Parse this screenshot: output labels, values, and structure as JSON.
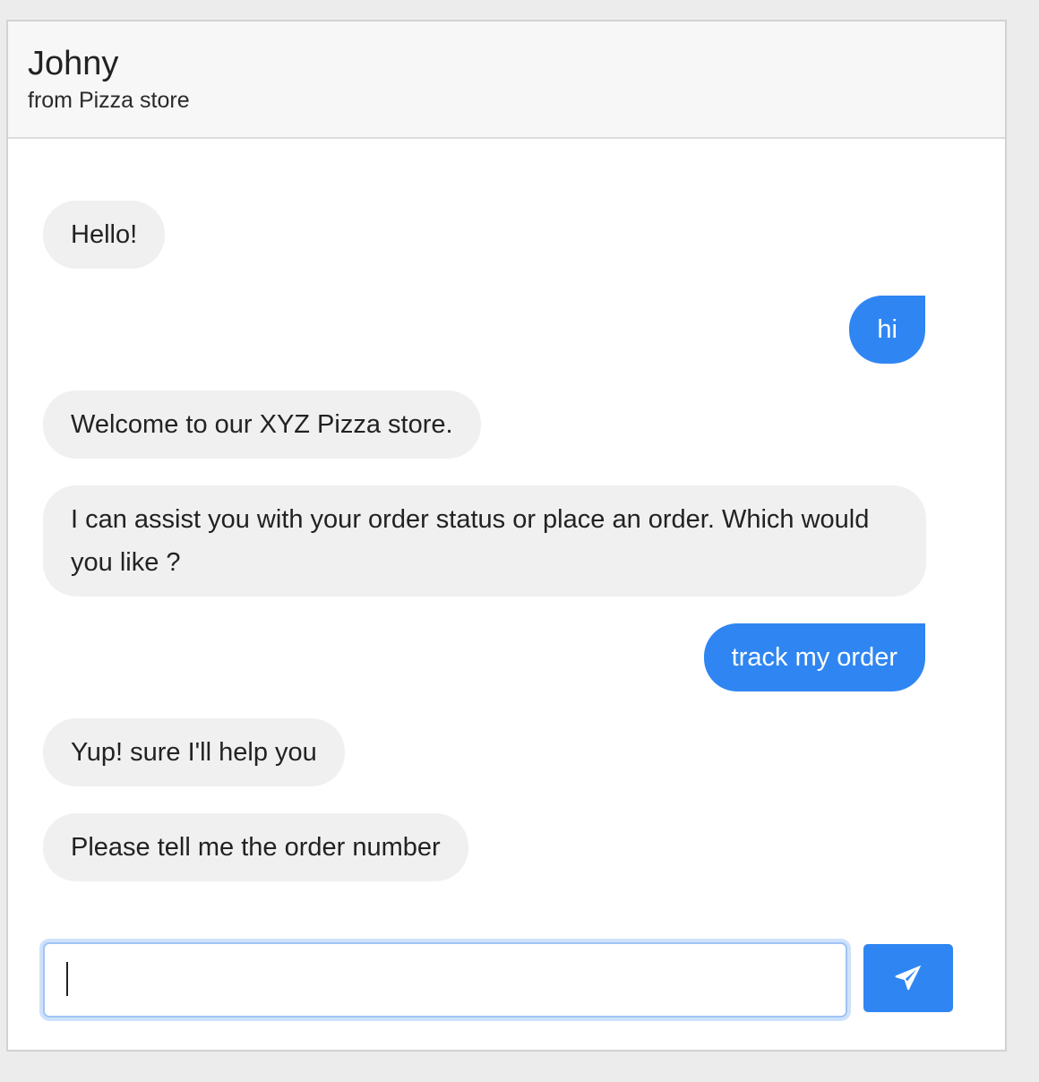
{
  "header": {
    "name": "Johny",
    "subtitle": "from Pizza store"
  },
  "messages": [
    {
      "sender": "bot",
      "text": "Hello!"
    },
    {
      "sender": "user",
      "text": "hi"
    },
    {
      "sender": "bot",
      "text": "Welcome to our XYZ Pizza store."
    },
    {
      "sender": "bot",
      "text": "I can assist you with your order status or place an order. Which would you like ?"
    },
    {
      "sender": "user",
      "text": "track my order"
    },
    {
      "sender": "bot",
      "text": "Yup! sure I'll help you"
    },
    {
      "sender": "bot",
      "text": "Please tell me the order number"
    }
  ],
  "input": {
    "value": "",
    "placeholder": ""
  },
  "send_button": {
    "icon": "paper-plane-icon"
  },
  "colors": {
    "accent": "#2f86f2",
    "bot_bubble": "#f0f0f0",
    "header_bg": "#f7f7f7",
    "page_bg": "#ececec"
  }
}
